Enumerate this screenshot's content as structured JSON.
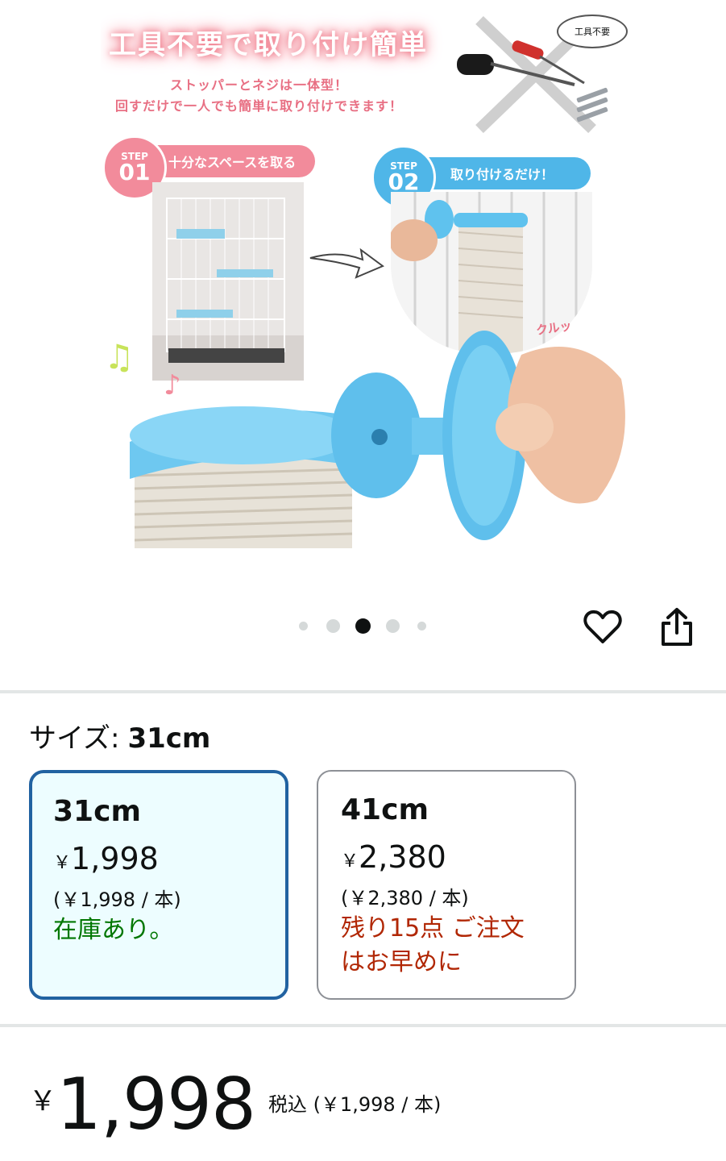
{
  "product_image": {
    "headline": "工具不要で取り付け簡単",
    "subline1": "ストッパーとネジは一体型！",
    "subline2": "回すだけで一人でも簡単に取り付けできます！",
    "tool_bubble": "工具不要",
    "step1": {
      "word": "STEP",
      "num": "01",
      "text": "十分なスペースを取る"
    },
    "step2": {
      "word": "STEP",
      "num": "02",
      "text": "取り付けるだけ！"
    },
    "sound": "クルッ"
  },
  "carousel": {
    "total": 5,
    "active_index": 2
  },
  "actions": {
    "favorite_icon": "heart-icon",
    "share_icon": "share-icon"
  },
  "size_selector": {
    "label": "サイズ:",
    "selected_value": "31cm",
    "options": [
      {
        "size": "31cm",
        "yen": "￥",
        "price": "1,998",
        "unit_price": "(￥1,998 / 本)",
        "stock": "在庫あり。",
        "stock_status": "in-stock"
      },
      {
        "size": "41cm",
        "yen": "￥",
        "price": "2,380",
        "unit_price": "(￥2,380 / 本)",
        "stock_line1": "残り15点 ご注文",
        "stock_line2": "はお早めに",
        "stock_status": "low-stock"
      }
    ]
  },
  "price": {
    "yen": "￥",
    "amount": "1,998",
    "tax_note": "税込 (￥1,998 / 本)"
  },
  "colors": {
    "selected_border": "#2162a1",
    "selected_bg": "#edfdff",
    "in_stock": "#007600",
    "low_stock": "#b12704",
    "accent_pink": "#e86f83",
    "accent_blue": "#4fb6e8"
  }
}
